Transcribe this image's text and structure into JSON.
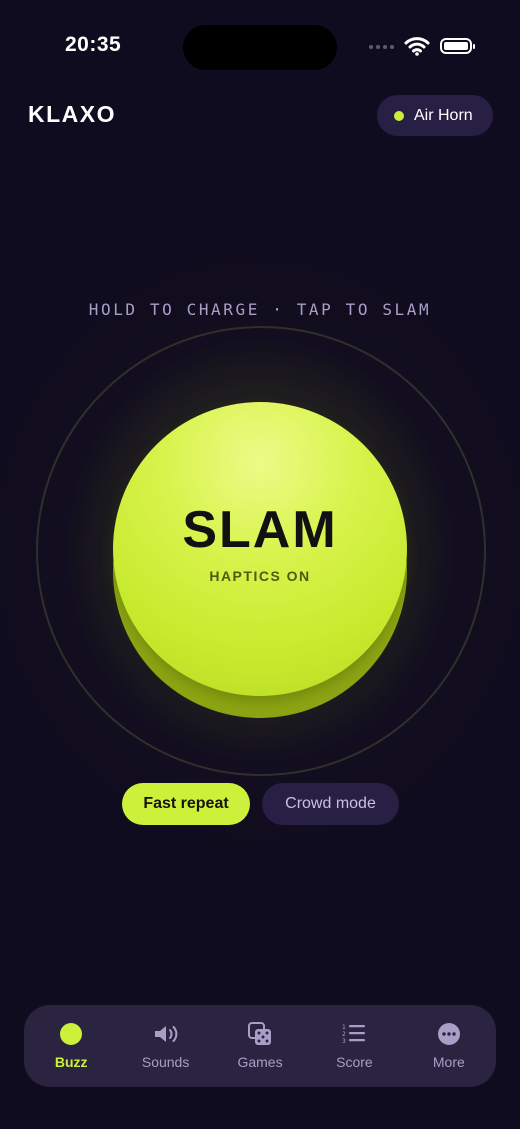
{
  "status_bar": {
    "time": "20:35"
  },
  "header": {
    "brand": "KLAXO",
    "sound_pill": "Air Horn"
  },
  "main": {
    "hint": "HOLD TO CHARGE · TAP TO SLAM",
    "button_label": "SLAM",
    "button_sublabel": "HAPTICS ON",
    "chips": [
      {
        "label": "Fast repeat",
        "active": true
      },
      {
        "label": "Crowd mode",
        "active": false
      }
    ]
  },
  "tabbar": {
    "tabs": [
      {
        "label": "Buzz",
        "icon": "buzz-dot-icon",
        "active": true
      },
      {
        "label": "Sounds",
        "icon": "speaker-icon",
        "active": false
      },
      {
        "label": "Games",
        "icon": "dice-icon",
        "active": false
      },
      {
        "label": "Score",
        "icon": "numbered-list-icon",
        "active": false
      },
      {
        "label": "More",
        "icon": "more-dots-icon",
        "active": false
      }
    ]
  },
  "colors": {
    "accent": "#cdf03a",
    "background": "#100c1f",
    "surface": "#271f44",
    "muted_text": "#a99ec6"
  }
}
